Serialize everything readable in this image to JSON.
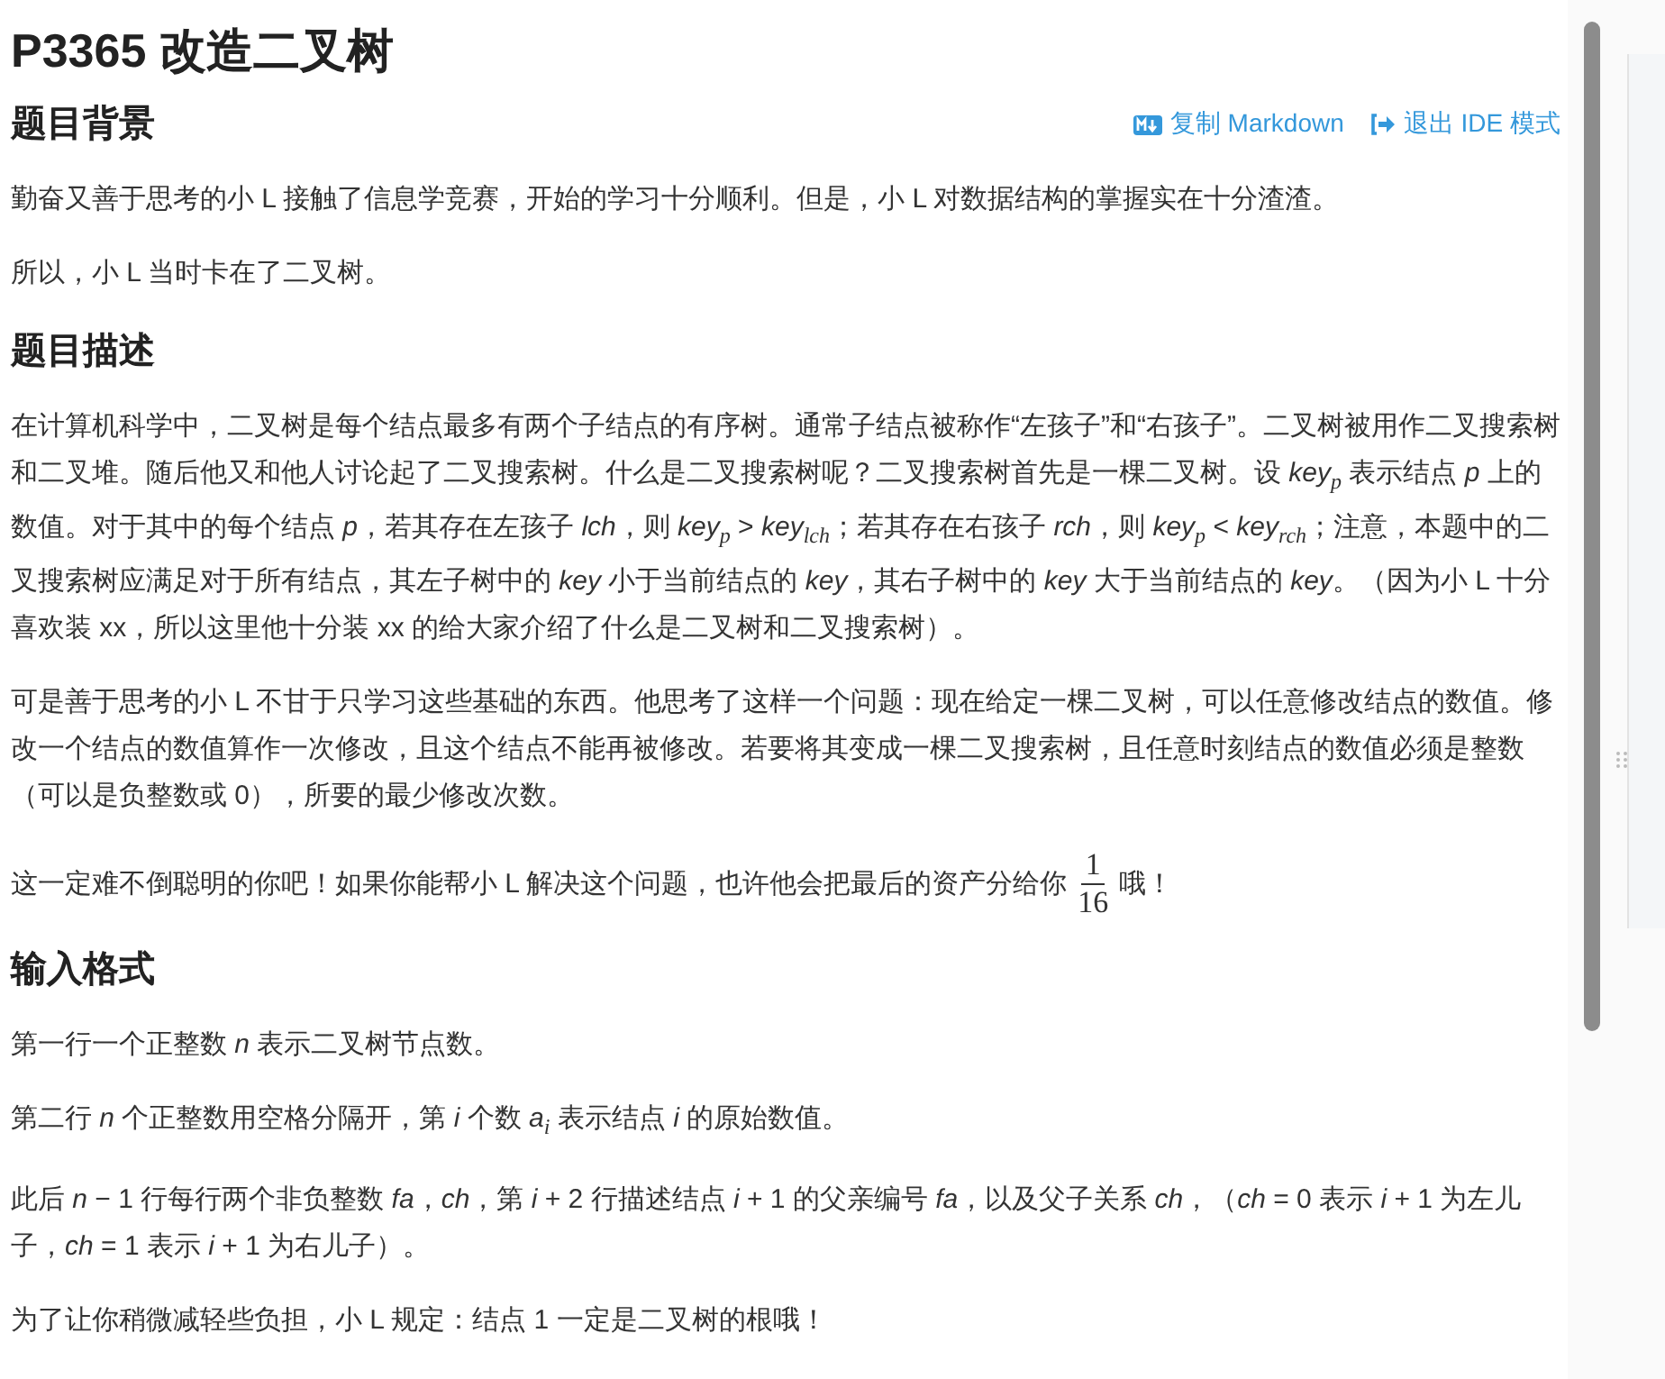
{
  "title": "P3365 改造二叉树",
  "toolbar": [
    {
      "kind": "markdown",
      "label": "复制 Markdown"
    },
    {
      "kind": "exit",
      "label": "退出 IDE 模式"
    }
  ],
  "sections": [
    {
      "heading": "题目背景",
      "paragraphs": [
        {
          "kind": "text",
          "text": "勤奋又善于思考的小 L 接触了信息学竞赛，开始的学习十分顺利。但是，小 L 对数据结构的掌握实在十分渣渣。"
        },
        {
          "kind": "text",
          "text": "所以，小 L 当时卡在了二叉树。"
        }
      ]
    },
    {
      "heading": "题目描述",
      "paragraphs": [
        {
          "kind": "text",
          "text": "在计算机科学中，二叉树是每个结点最多有两个子结点的有序树。通常子结点被称作“左孩子”和“右孩子”。二叉树被用作二叉搜索树和二叉堆。随后他又和他人讨论起了二叉搜索树。什么是二叉搜索树呢？二叉搜索树首先是一棵二叉树。设 *key*$_{p}$ 表示结点 *p* 上的数值。对于其中的每个结点 *p*，若其存在左孩子 *lch*，则 *key*$_{p}$ > *key*$_{lch}$；若其存在右孩子 *rch*，则 *key*$_{p}$ < *key*$_{rch}$；注意，本题中的二叉搜索树应满足对于所有结点，其左子树中的 *key* 小于当前结点的 *key*，其右子树中的 *key* 大于当前结点的 *key*。（因为小 L 十分喜欢装 xx，所以这里他十分装 xx 的给大家介绍了什么是二叉树和二叉搜索树）。"
        },
        {
          "kind": "text",
          "text": "可是善于思考的小 L 不甘于只学习这些基础的东西。他思考了这样一个问题：现在给定一棵二叉树，可以任意修改结点的数值。修改一个结点的数值算作一次修改，且这个结点不能再被修改。若要将其变成一棵二叉搜索树，且任意时刻结点的数值必须是整数（可以是负整数或 0），所要的最少修改次数。"
        },
        {
          "kind": "fraction",
          "before": "这一定难不倒聪明的你吧！如果你能帮小 L 解决这个问题，也许他会把最后的资产分给你",
          "numerator": "1",
          "denominator": "16",
          "after": "哦！"
        }
      ]
    },
    {
      "heading": "输入格式",
      "paragraphs": [
        {
          "kind": "text",
          "text": "第一行一个正整数 *n* 表示二叉树节点数。"
        },
        {
          "kind": "text",
          "text": "第二行 *n* 个正整数用空格分隔开，第 *i* 个数 *a*$_{i}$ 表示结点 *i* 的原始数值。"
        },
        {
          "kind": "text",
          "text": "此后 *n* − 1 行每行两个非负整数 *fa*，*ch*，第 *i* + 2 行描述结点 *i* + 1 的父亲编号 *fa*，以及父子关系 *ch*，（*ch* = 0 表示 *i* + 1 为左儿子，*ch* = 1 表示 *i* + 1 为右儿子）。"
        },
        {
          "kind": "text",
          "text": "为了让你稍微减轻些负担，小 L 规定：结点 1 一定是二叉树的根哦！"
        }
      ]
    }
  ]
}
